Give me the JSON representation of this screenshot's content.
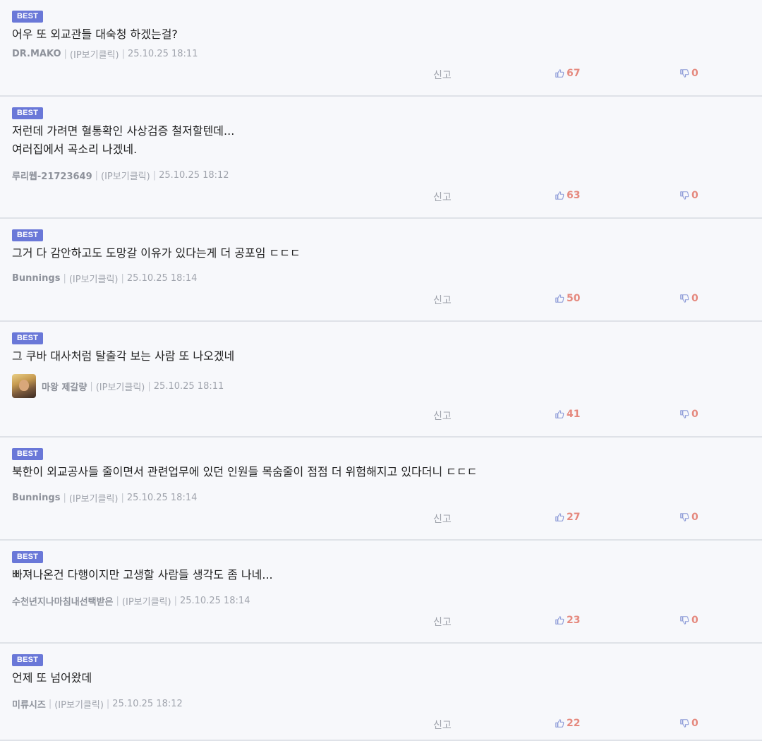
{
  "labels": {
    "best_badge": "BEST",
    "report": "신고",
    "ip_text": "(IP보기클릭)"
  },
  "comments": [
    {
      "lines": [
        "어우 또 외교관들 대숙청 하겠는걸?"
      ],
      "author": "DR.MAKO",
      "datetime": "25.10.25 18:11",
      "likes": "67",
      "dislikes": "0",
      "has_avatar": false
    },
    {
      "lines": [
        "저런데 가려면 혈통확인 사상검증 철저할텐데...",
        "여러집에서 곡소리 나겠네."
      ],
      "author": "루리웹-21723649",
      "datetime": "25.10.25 18:12",
      "likes": "63",
      "dislikes": "0",
      "has_avatar": false
    },
    {
      "lines": [
        "그거 다 감안하고도 도망갈 이유가 있다는게 더 공포임 ㄷㄷㄷ"
      ],
      "author": "Bunnings",
      "datetime": "25.10.25 18:14",
      "likes": "50",
      "dislikes": "0",
      "has_avatar": false
    },
    {
      "lines": [
        "그 쿠바 대사처럼 탈출각 보는 사람 또 나오겠네"
      ],
      "author": "마왕 제갈량",
      "datetime": "25.10.25 18:11",
      "likes": "41",
      "dislikes": "0",
      "has_avatar": true
    },
    {
      "lines": [
        "북한이 외교공사들 줄이면서 관련업무에 있던 인원들 목숨줄이 점점 더 위험해지고 있다더니 ㄷㄷㄷ"
      ],
      "author": "Bunnings",
      "datetime": "25.10.25 18:14",
      "likes": "27",
      "dislikes": "0",
      "has_avatar": false
    },
    {
      "lines": [
        "빠져나온건 다행이지만 고생할 사람들 생각도 좀 나네..."
      ],
      "author": "수천년지나마침내선택받은",
      "datetime": "25.10.25 18:14",
      "likes": "23",
      "dislikes": "0",
      "has_avatar": false
    },
    {
      "lines": [
        "언제 또 넘어왔데"
      ],
      "author": "미류시즈",
      "datetime": "25.10.25 18:12",
      "likes": "22",
      "dislikes": "0",
      "has_avatar": false
    }
  ]
}
